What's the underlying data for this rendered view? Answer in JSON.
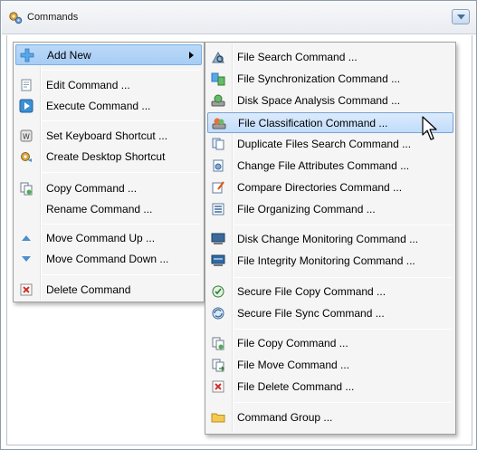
{
  "panel": {
    "title": "Commands",
    "title_icon": "gears-icon",
    "dropdown_icon": "chevron-down-icon"
  },
  "context_menu": {
    "items": [
      {
        "label": "Add New",
        "icon": "plus-icon",
        "submenu": true,
        "highlighted": true
      },
      {
        "label": "Edit Command ...",
        "icon": "edit-document-icon"
      },
      {
        "label": "Execute Command ...",
        "icon": "play-icon"
      },
      {
        "label": "Set Keyboard Shortcut ...",
        "icon": "keyboard-key-icon"
      },
      {
        "label": "Create Desktop Shortcut",
        "icon": "shortcut-icon"
      },
      {
        "label": "Copy Command ...",
        "icon": "copy-icon"
      },
      {
        "label": "Rename Command ...",
        "icon": ""
      },
      {
        "label": "Move Command Up ...",
        "icon": "triangle-up-icon"
      },
      {
        "label": "Move Command Down ...",
        "icon": "triangle-down-icon"
      },
      {
        "label": "Delete Command",
        "icon": "delete-x-icon"
      }
    ]
  },
  "submenu": {
    "items": [
      {
        "label": "File Search Command ...",
        "icon": "file-search-icon"
      },
      {
        "label": "File Synchronization Command ...",
        "icon": "file-sync-icon"
      },
      {
        "label": "Disk Space Analysis Command ...",
        "icon": "disk-space-icon"
      },
      {
        "label": "File Classification Command ...",
        "icon": "file-classification-icon",
        "highlighted": true
      },
      {
        "label": "Duplicate Files Search Command ...",
        "icon": "duplicate-files-icon"
      },
      {
        "label": "Change File Attributes Command ...",
        "icon": "file-attributes-icon"
      },
      {
        "label": "Compare Directories Command ...",
        "icon": "compare-directories-icon"
      },
      {
        "label": "File Organizing Command ...",
        "icon": "file-organizing-icon"
      },
      {
        "label": "Disk Change Monitoring Command ...",
        "icon": "disk-monitor-icon"
      },
      {
        "label": "File Integrity Monitoring Command ...",
        "icon": "integrity-monitor-icon"
      },
      {
        "label": "Secure File Copy Command ...",
        "icon": "secure-copy-icon"
      },
      {
        "label": "Secure File Sync Command ...",
        "icon": "secure-sync-icon"
      },
      {
        "label": "File Copy Command ...",
        "icon": "file-copy-icon"
      },
      {
        "label": "File Move Command ...",
        "icon": "file-move-icon"
      },
      {
        "label": "File Delete Command ...",
        "icon": "file-delete-icon"
      },
      {
        "label": "Command Group ...",
        "icon": "folder-icon"
      }
    ]
  },
  "colors": {
    "highlight_main": "#a6cdf5",
    "highlight_sub": "#c1dcfc",
    "menu_bg": "#f5f5f5"
  }
}
